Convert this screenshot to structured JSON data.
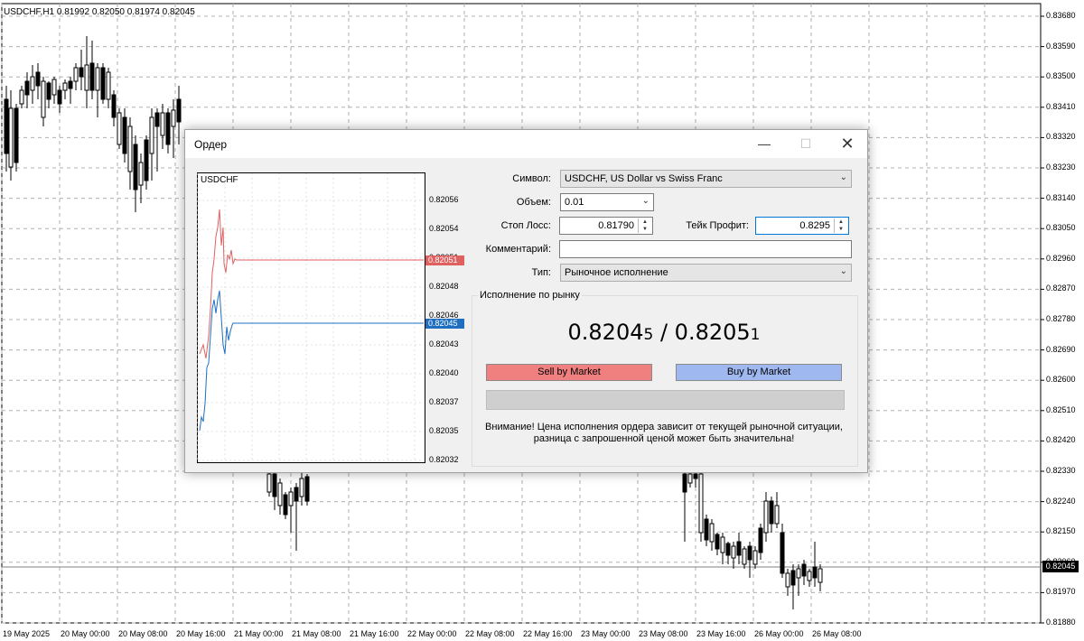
{
  "chart": {
    "header": "USDCHF,H1  0.81992 0.82050 0.81974 0.82045",
    "price_axis": [
      "0.83680",
      "0.83590",
      "0.83500",
      "0.83410",
      "0.83320",
      "0.83230",
      "0.83140",
      "0.83050",
      "0.82960",
      "0.82870",
      "0.82780",
      "0.82690",
      "0.82600",
      "0.82510",
      "0.82420",
      "0.82330",
      "0.82240",
      "0.82150",
      "0.82060",
      "0.81970",
      "0.81880"
    ],
    "time_axis": [
      "19 May 2025",
      "20 May 00:00",
      "20 May 08:00",
      "20 May 16:00",
      "21 May 00:00",
      "21 May 08:00",
      "21 May 16:00",
      "22 May 00:00",
      "22 May 08:00",
      "22 May 16:00",
      "23 May 00:00",
      "23 May 08:00",
      "23 May 16:00",
      "26 May 00:00",
      "26 May 08:00"
    ],
    "last_price": "0.82045",
    "colors": {
      "candle": "#000000",
      "grid": "#c0c0c0",
      "last_price_bg": "#000000"
    }
  },
  "dialog": {
    "title": "Ордер",
    "minimize_icon": "—",
    "maximize_icon": "☐",
    "close_icon": "✕",
    "mini_chart": {
      "symbol": "USDCHF",
      "ticks": [
        "0.82056",
        "0.82054",
        "0.82051",
        "0.82048",
        "0.82046",
        "0.82043",
        "0.82040",
        "0.82037",
        "0.82035",
        "0.82032"
      ],
      "ask_tag": "0.82051",
      "bid_tag": "0.82045",
      "colors": {
        "ask": "#e06060",
        "bid": "#1f6fc0"
      }
    },
    "form": {
      "symbol_label": "Символ:",
      "symbol_value": "USDCHF, US Dollar vs Swiss Franc",
      "volume_label": "Объем:",
      "volume_value": "0.01",
      "sl_label": "Стоп Лосс:",
      "sl_value": "0.81790",
      "tp_label": "Тейк Профит:",
      "tp_value": "0.8295",
      "comment_label": "Комментарий:",
      "comment_value": "",
      "type_label": "Тип:",
      "type_value": "Рыночное исполнение"
    },
    "execution": {
      "group_label": "Исполнение по рынку",
      "bid_main": "0.8204",
      "bid_small": "5",
      "separator": " / ",
      "ask_main": "0.8205",
      "ask_small": "1",
      "sell_label": "Sell by Market",
      "buy_label": "Buy by Market",
      "warning_line1": "Внимание! Цена исполнения ордера зависит от текущей рыночной ситуации,",
      "warning_line2": "разница с запрошенной ценой может быть значительна!",
      "colors": {
        "sell": "#f08080",
        "buy": "#a0b8f0"
      }
    }
  }
}
